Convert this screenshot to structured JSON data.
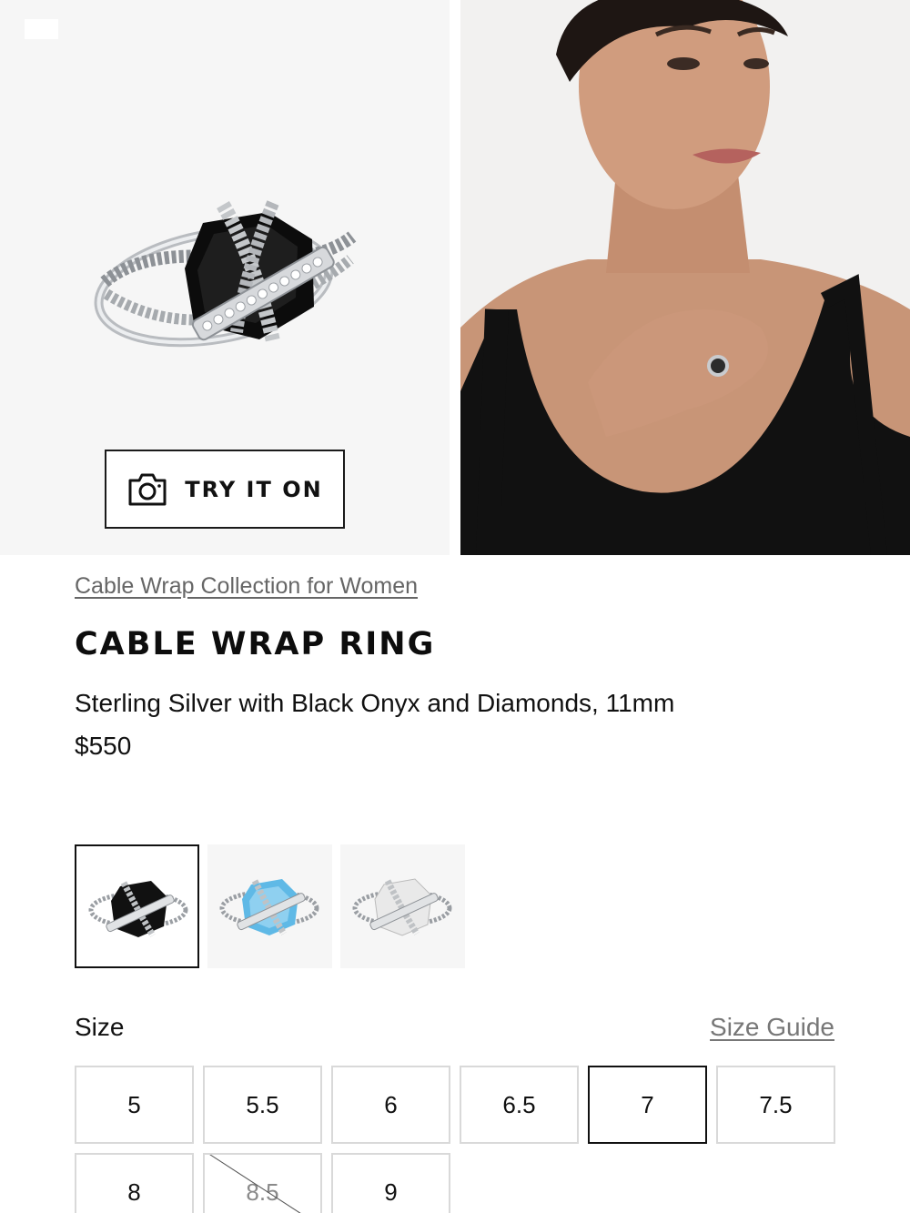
{
  "gallery": {
    "try_on_label": "TRY IT ON"
  },
  "product": {
    "collection_link": "Cable Wrap Collection for Women",
    "title": "CABLE WRAP RING",
    "subtitle": "Sterling Silver with Black Onyx and Diamonds, 11mm",
    "price": "$550"
  },
  "variants": [
    {
      "stone": "black-onyx",
      "color": "#111111",
      "selected": true
    },
    {
      "stone": "blue-topaz",
      "color": "#5fb9e6",
      "selected": false
    },
    {
      "stone": "white-topaz",
      "color": "#e9e9e9",
      "selected": false
    }
  ],
  "size": {
    "label": "Size",
    "guide_label": "Size Guide",
    "options": [
      "5",
      "5.5",
      "6",
      "6.5",
      "7",
      "7.5",
      "8",
      "8.5",
      "9"
    ],
    "selected": "7",
    "unavailable": [
      "8.5"
    ]
  }
}
